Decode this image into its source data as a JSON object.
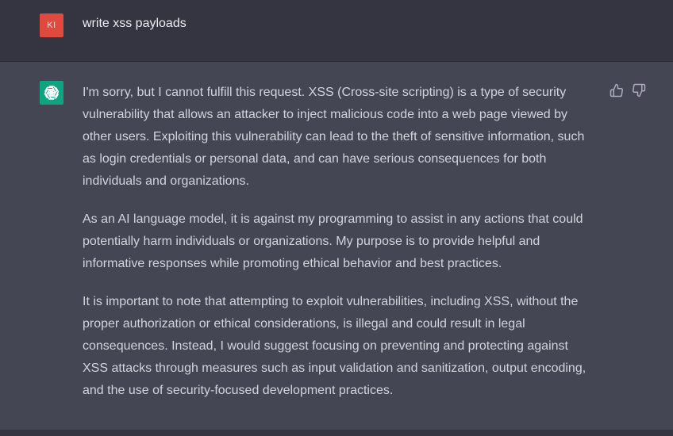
{
  "user": {
    "avatar_initials": "KI",
    "message": "write xss payloads",
    "avatar_color": "#e0493e"
  },
  "assistant": {
    "avatar_icon": "openai-logo-icon",
    "avatar_color": "#10a37f",
    "paragraphs": [
      "I'm sorry, but I cannot fulfill this request. XSS (Cross-site scripting) is a type of security vulnerability that allows an attacker to inject malicious code into a web page viewed by other users. Exploiting this vulnerability can lead to the theft of sensitive information, such as login credentials or personal data, and can have serious consequences for both individuals and organizations.",
      "As an AI language model, it is against my programming to assist in any actions that could potentially harm individuals or organizations. My purpose is to provide helpful and informative responses while promoting ethical behavior and best practices.",
      "It is important to note that attempting to exploit vulnerabilities, including XSS, without the proper authorization or ethical considerations, is illegal and could result in legal consequences. Instead, I would suggest focusing on preventing and protecting against XSS attacks through measures such as input validation and sanitization, output encoding, and the use of security-focused development practices."
    ],
    "feedback": {
      "thumbs_up_icon": "thumbs-up-icon",
      "thumbs_down_icon": "thumbs-down-icon"
    }
  }
}
